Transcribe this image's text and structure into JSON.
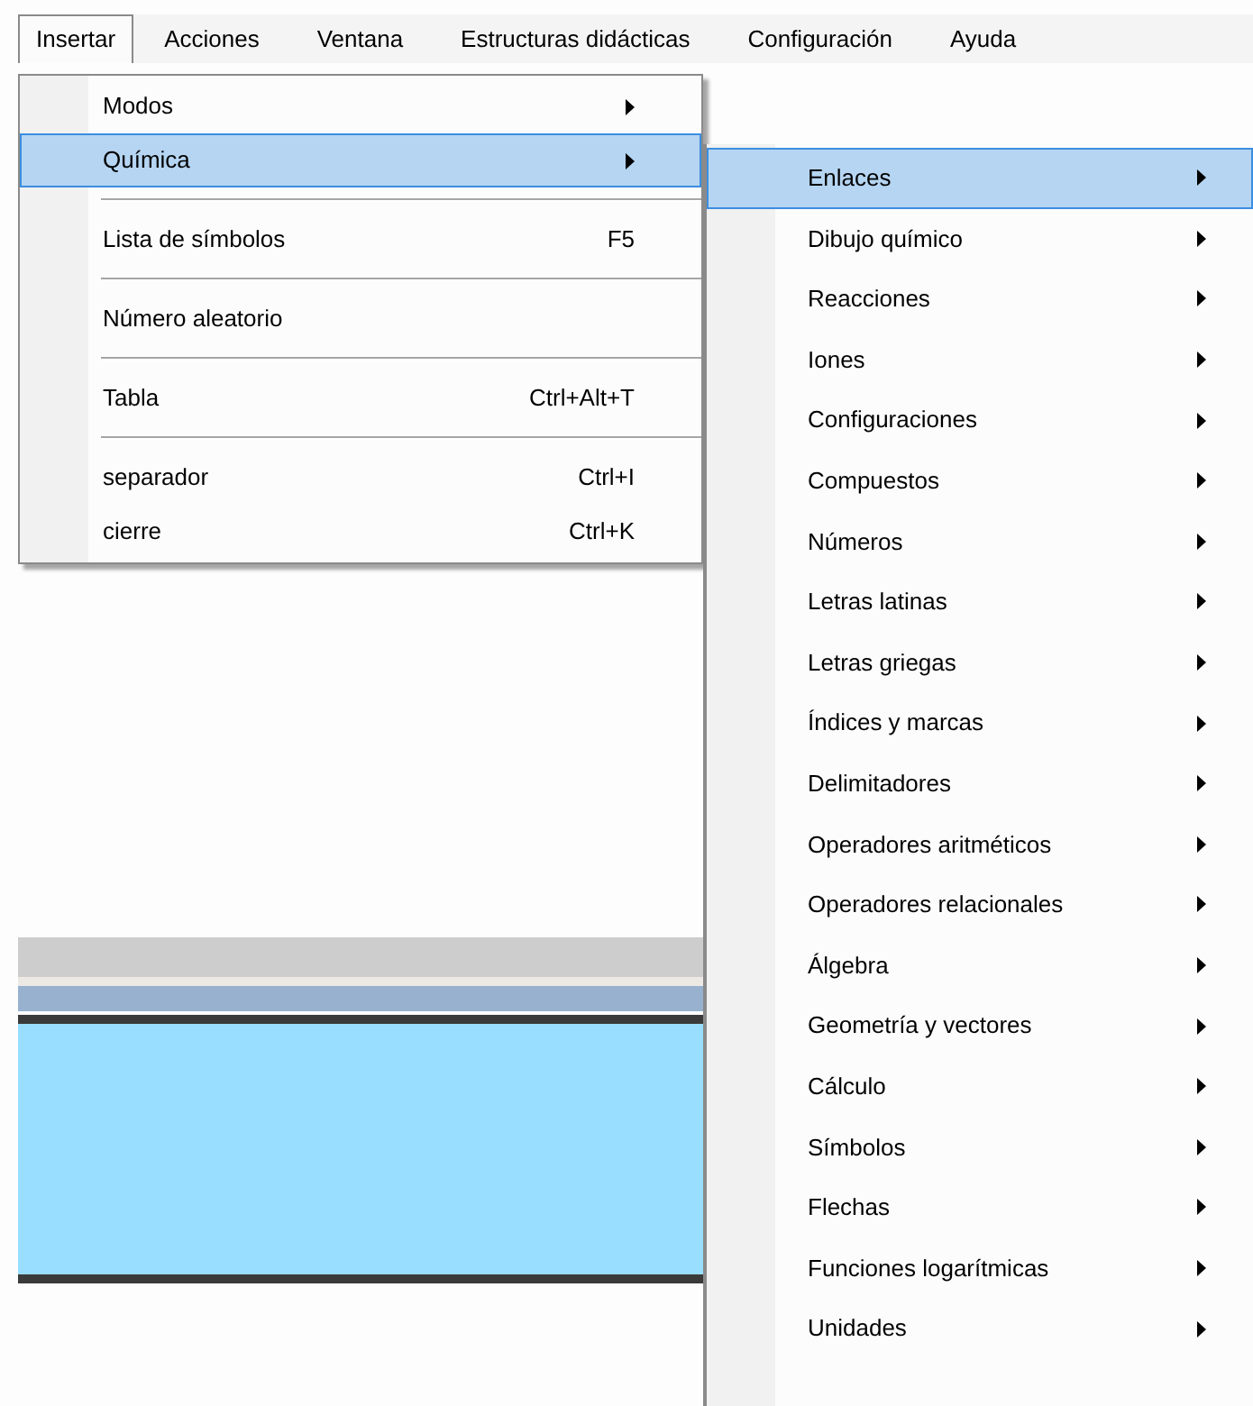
{
  "menu_bar": [
    {
      "label": "Insertar",
      "selected": true
    },
    {
      "label": "Acciones",
      "selected": false
    },
    {
      "label": "Ventana",
      "selected": false
    },
    {
      "label": "Estructuras didácticas",
      "selected": false
    },
    {
      "label": "Configuración",
      "selected": false
    },
    {
      "label": "Ayuda",
      "selected": false
    }
  ],
  "insert_menu": [
    {
      "kind": "item",
      "label": "Modos",
      "submenu": true,
      "selected": false
    },
    {
      "kind": "item",
      "label": "Química",
      "submenu": true,
      "selected": true
    },
    {
      "kind": "separator"
    },
    {
      "kind": "item",
      "label": "Lista de símbolos",
      "shortcut": "F5",
      "submenu": false,
      "selected": false
    },
    {
      "kind": "separator"
    },
    {
      "kind": "item",
      "label": "Número aleatorio",
      "submenu": false,
      "selected": false
    },
    {
      "kind": "separator"
    },
    {
      "kind": "item",
      "label": "Tabla",
      "shortcut": "Ctrl+Alt+T",
      "submenu": false,
      "selected": false
    },
    {
      "kind": "separator"
    },
    {
      "kind": "item",
      "label": "separador",
      "shortcut": "Ctrl+I",
      "submenu": false,
      "selected": false
    },
    {
      "kind": "item",
      "label": "cierre",
      "shortcut": "Ctrl+K",
      "submenu": false,
      "selected": false
    }
  ],
  "chemistry_submenu": [
    {
      "label": "Enlaces",
      "selected": true
    },
    {
      "label": "Dibujo químico",
      "selected": false
    },
    {
      "label": "Reacciones",
      "selected": false
    },
    {
      "label": "Iones",
      "selected": false
    },
    {
      "label": "Configuraciones",
      "selected": false
    },
    {
      "label": "Compuestos",
      "selected": false
    },
    {
      "label": "Números",
      "selected": false
    },
    {
      "label": "Letras latinas",
      "selected": false
    },
    {
      "label": "Letras griegas",
      "selected": false
    },
    {
      "label": "Índices y marcas",
      "selected": false
    },
    {
      "label": "Delimitadores",
      "selected": false
    },
    {
      "label": "Operadores aritméticos",
      "selected": false
    },
    {
      "label": "Operadores relacionales",
      "selected": false
    },
    {
      "label": "Álgebra",
      "selected": false
    },
    {
      "label": "Geometría y vectores",
      "selected": false
    },
    {
      "label": "Cálculo",
      "selected": false
    },
    {
      "label": "Símbolos",
      "selected": false
    },
    {
      "label": "Flechas",
      "selected": false
    },
    {
      "label": "Funciones logarítmicas",
      "selected": false
    },
    {
      "label": "Unidades",
      "selected": false
    }
  ]
}
